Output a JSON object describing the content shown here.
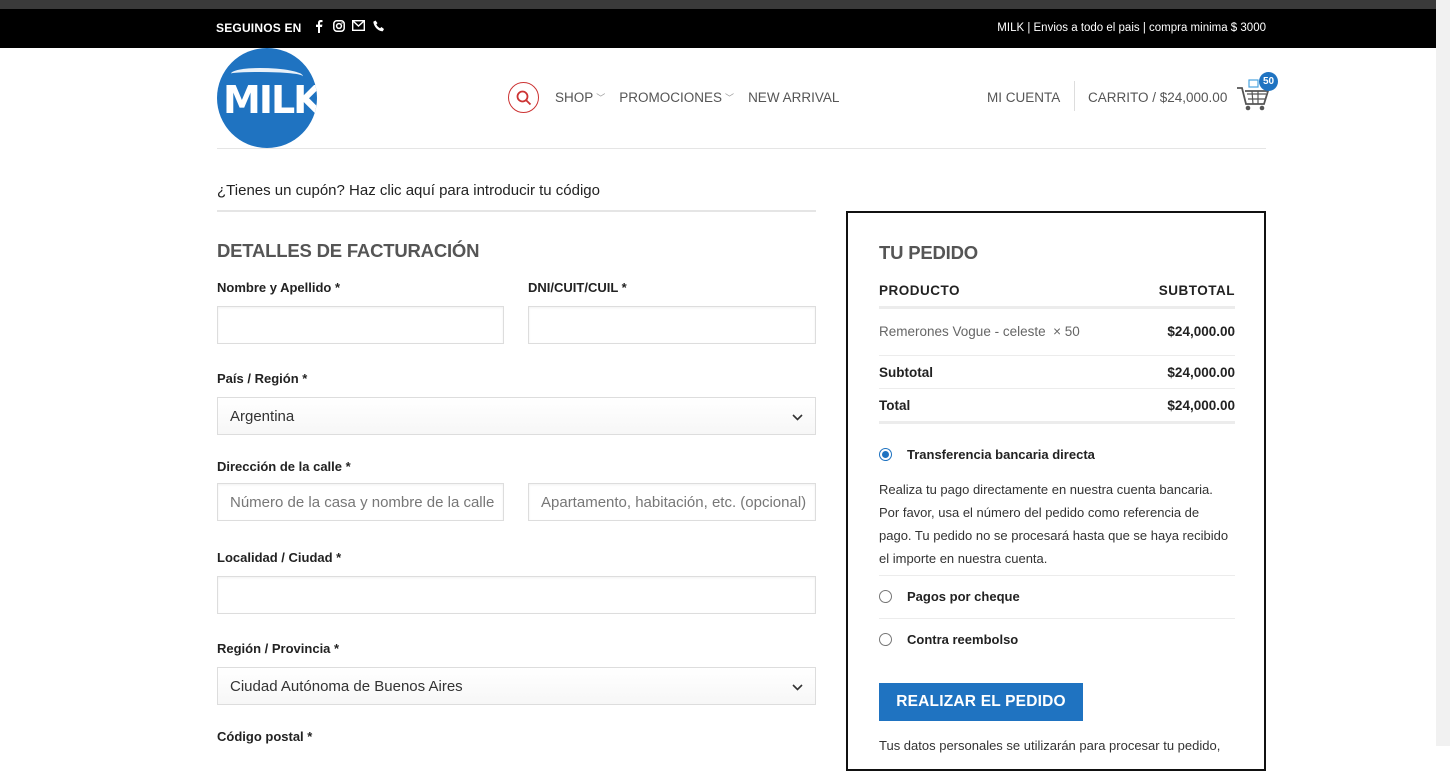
{
  "topbar": {
    "follow_label": "SEGUINOS EN",
    "social_icons": [
      "facebook-icon",
      "instagram-icon",
      "email-icon",
      "phone-icon"
    ],
    "promo_text": "MILK | Envios a todo el pais | compra minima $ 3000"
  },
  "header": {
    "logo_text": "MILK",
    "nav": {
      "shop": "SHOP",
      "promociones": "PROMOCIONES",
      "new_arrival": "NEW ARRIVAL"
    },
    "account_label": "MI CUENTA",
    "cart_label": "CARRITO / $24,000.00",
    "cart_count": "50"
  },
  "coupon_text": "¿Tienes un cupón? Haz clic aquí para introducir tu código",
  "billing": {
    "title": "DETALLES DE FACTURACIÓN",
    "fields": {
      "nombre_label": "Nombre y Apellido *",
      "nombre_value": "",
      "dni_label": "DNI/CUIT/CUIL *",
      "dni_value": "",
      "pais_label": "País / Región *",
      "pais_value": "Argentina",
      "direccion_label": "Dirección de la calle *",
      "direccion_placeholder": "Número de la casa y nombre de la calle",
      "apartamento_placeholder": "Apartamento, habitación, etc. (opcional)",
      "localidad_label": "Localidad / Ciudad *",
      "localidad_value": "",
      "region_label": "Región / Provincia *",
      "region_value": "Ciudad Autónoma de Buenos Aires",
      "postal_label": "Código postal *"
    }
  },
  "order": {
    "title": "TU PEDIDO",
    "col_product": "PRODUCTO",
    "col_subtotal": "SUBTOTAL",
    "item_name": "Remerones Vogue - celeste  × 50",
    "item_price": "$24,000.00",
    "subtotal_label": "Subtotal",
    "subtotal_value": "$24,000.00",
    "total_label": "Total",
    "total_value": "$24,000.00",
    "payment_methods": {
      "transfer": "Transferencia bancaria directa",
      "transfer_desc": "Realiza tu pago directamente en nuestra cuenta bancaria. Por favor, usa el número del pedido como referencia de pago. Tu pedido no se procesará hasta que se haya recibido el importe en nuestra cuenta.",
      "cheque": "Pagos por cheque",
      "cod": "Contra reembolso"
    },
    "place_order": "REALIZAR EL PEDIDO",
    "privacy_text": "Tus datos personales se utilizarán para procesar tu pedido,"
  },
  "colors": {
    "brand_blue": "#1f73c1",
    "search_red": "#cc3333",
    "topbar_bg": "#000000"
  }
}
